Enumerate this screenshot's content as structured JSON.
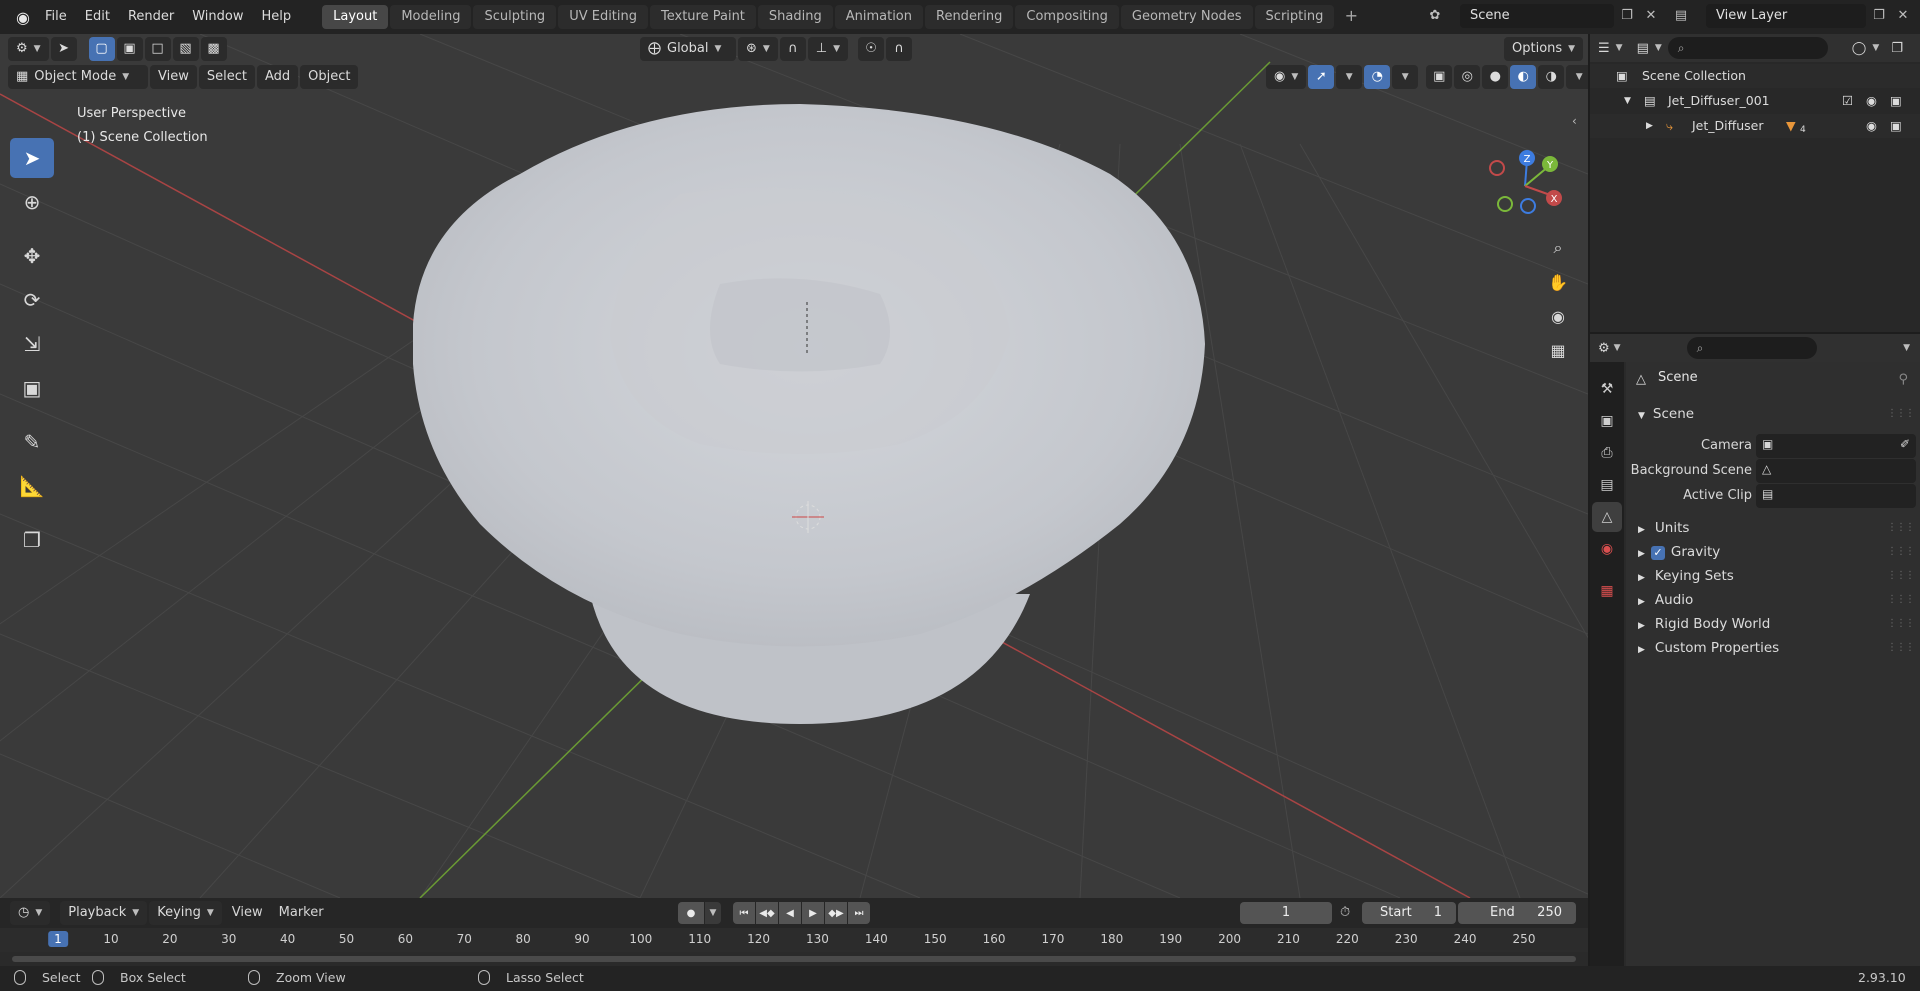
{
  "topbar": {
    "menus": [
      "File",
      "Edit",
      "Render",
      "Window",
      "Help"
    ],
    "workspaces": [
      "Layout",
      "Modeling",
      "Sculpting",
      "UV Editing",
      "Texture Paint",
      "Shading",
      "Animation",
      "Rendering",
      "Compositing",
      "Geometry Nodes",
      "Scripting"
    ],
    "add_workspace": "+",
    "scene_name": "Scene",
    "view_layer": "View Layer"
  },
  "viewport": {
    "transform_orientation": "Global",
    "options_label": "Options",
    "mode": "Object Mode",
    "menus": [
      "View",
      "Select",
      "Add",
      "Object"
    ],
    "perspective": "User Perspective",
    "collection": "(1) Scene Collection",
    "gizmo": {
      "z": "Z",
      "y": "Y",
      "x": "X"
    }
  },
  "outliner": {
    "root": "Scene Collection",
    "collection": "Jet_Diffuser_001",
    "object": "Jet_Diffuser",
    "object_badge": "4"
  },
  "properties": {
    "context": "Scene",
    "panel": "Scene",
    "fields": [
      {
        "label": "Camera"
      },
      {
        "label": "Background Scene"
      },
      {
        "label": "Active Clip"
      }
    ],
    "collapsed_panels": [
      "Units",
      "Gravity",
      "Keying Sets",
      "Audio",
      "Rigid Body World",
      "Custom Properties"
    ],
    "gravity_checked": true
  },
  "timeline": {
    "menus": [
      "Playback",
      "Keying",
      "View",
      "Marker"
    ],
    "current_frame": "1",
    "start_label": "Start",
    "start_value": "1",
    "end_label": "End",
    "end_value": "250",
    "ruler": [
      "1",
      "10",
      "20",
      "30",
      "40",
      "50",
      "60",
      "70",
      "80",
      "90",
      "100",
      "110",
      "120",
      "130",
      "140",
      "150",
      "160",
      "170",
      "180",
      "190",
      "200",
      "210",
      "220",
      "230",
      "240",
      "250"
    ]
  },
  "statusbar": {
    "select": "Select",
    "box_select": "Box Select",
    "zoom_view": "Zoom View",
    "lasso_select": "Lasso Select",
    "version": "2.93.10"
  },
  "colors": {
    "accent": "#4772b3",
    "x_axis": "#c24a4a",
    "y_axis": "#7bb83a",
    "z_axis": "#3d7ce0",
    "mesh": "#c9ccd2"
  }
}
